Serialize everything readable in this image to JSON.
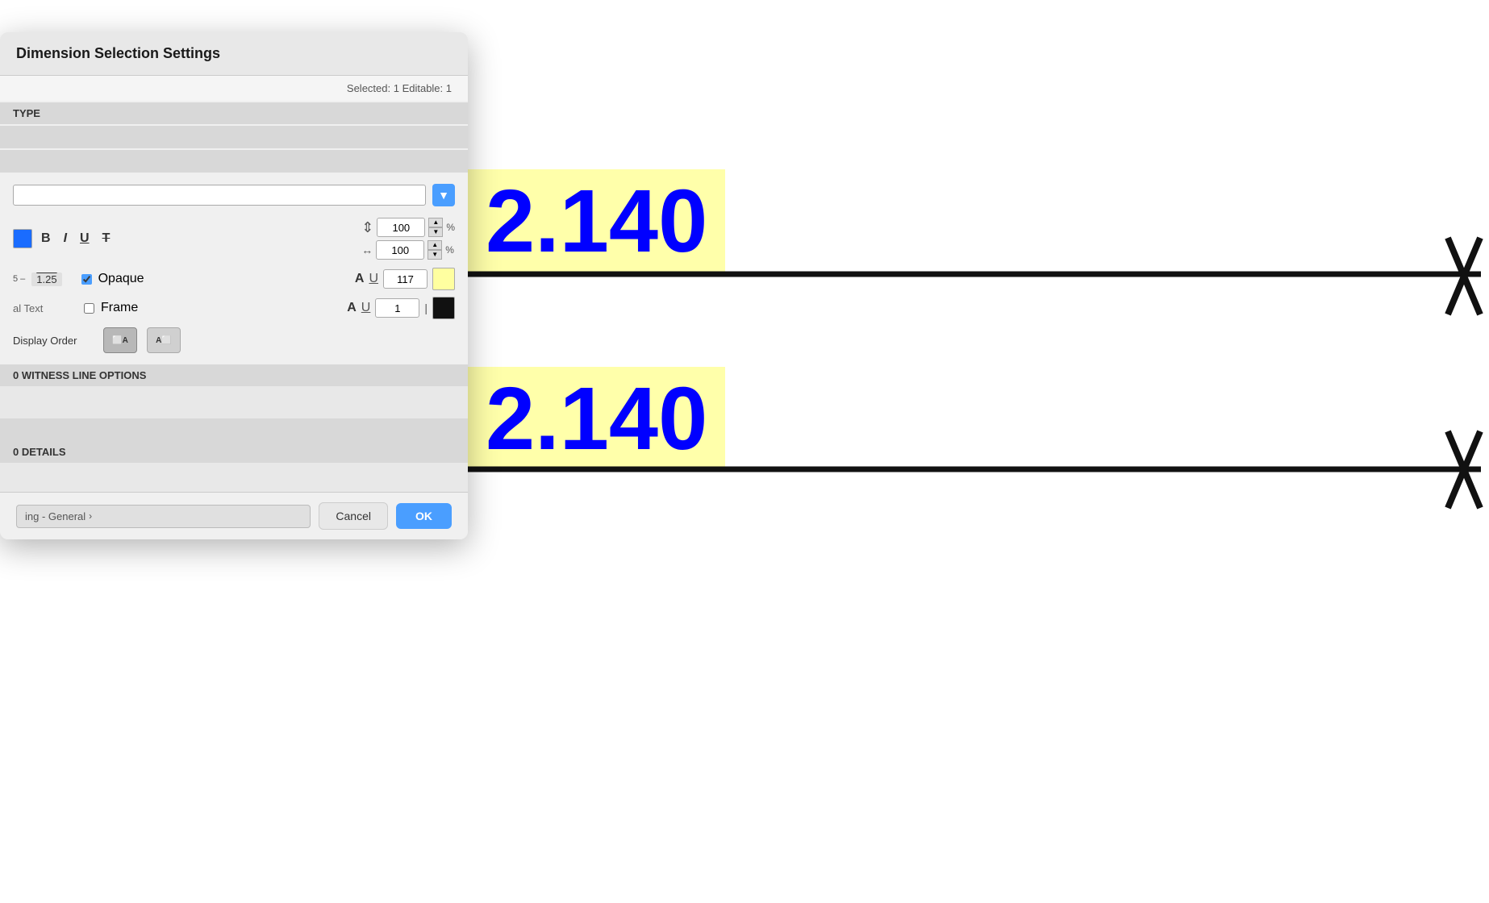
{
  "dialog": {
    "title": "Dimension Selection Settings",
    "selected_info": "Selected: 1 Editable: 1",
    "type_section_label": "TYPE",
    "witness_section_label": "0 WITNESS LINE OPTIONS",
    "details_section_label": "0 DETAILS",
    "format": {
      "bold_label": "B",
      "italic_label": "I",
      "underline_label": "U",
      "strikethrough_label": "T",
      "height_value": "100",
      "scale_value": "100",
      "pct_label": "%",
      "opaque_checked": true,
      "opaque_label": "Opaque",
      "frame_checked": false,
      "frame_label": "Frame",
      "text_color_value": "117",
      "frame_value": "1",
      "display_order_label": "Display Order",
      "display_order_btn1_label": "A_front",
      "display_order_btn2_label": "A_back",
      "optional_text_label": "al Text"
    },
    "overline_sample": "1.25",
    "dropdown_chevron": "▼",
    "footer": {
      "settings_label": "ing - General",
      "chevron": "›",
      "cancel_label": "Cancel",
      "ok_label": "OK"
    }
  },
  "canvas": {
    "dim_value_top": "2.140",
    "dim_value_bottom": "2.140"
  },
  "icons": {
    "spinner_up": "▲",
    "spinner_down": "▼",
    "height_icon": "⇕",
    "scale_icon": "↔"
  }
}
